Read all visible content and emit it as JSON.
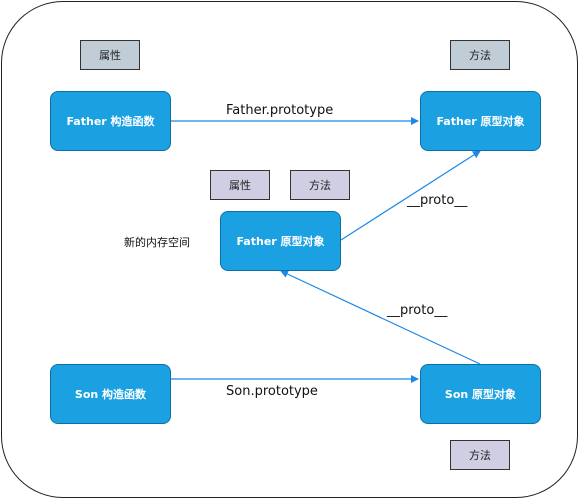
{
  "nodes": {
    "father_constructor": "Father 构造函数",
    "father_prototype_top": "Father 原型对象",
    "father_prototype_mid": "Father 原型对象",
    "son_constructor": "Son 构造函数",
    "son_prototype": "Son 原型对象"
  },
  "tags": {
    "top_property": "属性",
    "top_method": "方法",
    "mid_property": "属性",
    "mid_method": "方法",
    "bottom_method": "方法"
  },
  "edge_labels": {
    "father_prototype": "Father.prototype",
    "son_prototype": "Son.prototype",
    "proto_upper": "__proto__",
    "proto_lower": "__proto__"
  },
  "annotations": {
    "new_memory": "新的内存空间"
  },
  "colors": {
    "node_fill": "#1ba1e2",
    "edge": "#1e88e5",
    "tag_gray": "#c0ccd6",
    "tag_lavender": "#d0cee2"
  }
}
